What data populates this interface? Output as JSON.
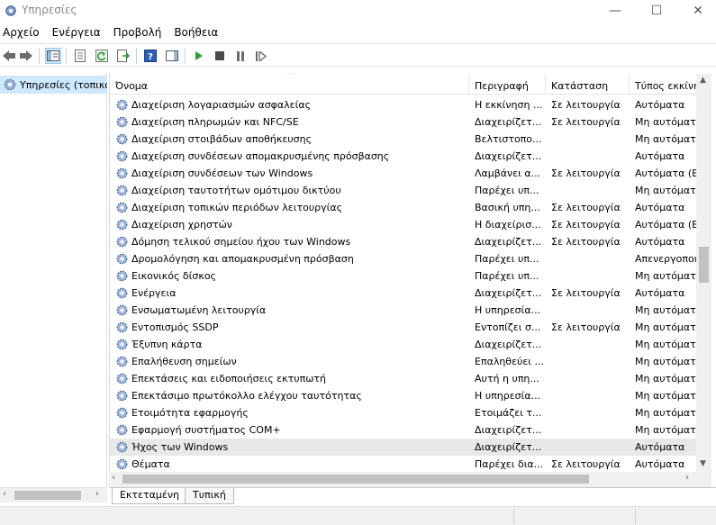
{
  "window": {
    "title": "Υπηρεσίες",
    "minimize": "—",
    "maximize": "☐",
    "close": "✕"
  },
  "menu": [
    "Αρχείο",
    "Ενέργεια",
    "Προβολή",
    "Βοήθεια"
  ],
  "toolbar": [
    "back-arrow",
    "forward-arrow",
    "show-tree",
    "properties",
    "refresh",
    "export-list",
    "help",
    "show-action-pane",
    "start-service",
    "stop-service",
    "pause-service",
    "restart-service"
  ],
  "tree": {
    "root_label": "Υπηρεσίες (τοπικά)"
  },
  "columns": {
    "name": "Όνομα",
    "description": "Περιγραφή",
    "status": "Κατάσταση",
    "startup": "Τύπος εκκίνησης"
  },
  "services": [
    {
      "name": "Διαχείριση λογαριασμών ασφαλείας",
      "description": "Η εκκίνηση ...",
      "status": "Σε λειτουργία",
      "startup": "Αυτόματα"
    },
    {
      "name": "Διαχείριση πληρωμών και NFC/SE",
      "description": "Διαχειρίζετ...",
      "status": "Σε λειτουργία",
      "startup": "Μη αυτόματα"
    },
    {
      "name": "Διαχείριση στοιβάδων αποθήκευσης",
      "description": "Βελτιστοπο...",
      "status": "",
      "startup": "Μη αυτόματα"
    },
    {
      "name": "Διαχείριση συνδέσεων απομακρυσμένης πρόσβασης",
      "description": "Διαχειρίζετ...",
      "status": "",
      "startup": "Αυτόματα"
    },
    {
      "name": "Διαχείριση συνδέσεων των Windows",
      "description": "Λαμβάνει α...",
      "status": "Σε λειτουργία",
      "startup": "Αυτόματα (Ε"
    },
    {
      "name": "Διαχείριση ταυτοτήτων ομότιμου δικτύου",
      "description": "Παρέχει υπ...",
      "status": "",
      "startup": "Μη αυτόματα"
    },
    {
      "name": "Διαχείριση τοπικών περιόδων λειτουργίας",
      "description": "Βασική υπη...",
      "status": "Σε λειτουργία",
      "startup": "Αυτόματα"
    },
    {
      "name": "Διαχείριση χρηστών",
      "description": "Η διαχείρισ...",
      "status": "Σε λειτουργία",
      "startup": "Αυτόματα (Ε"
    },
    {
      "name": "Δόμηση τελικού σημείου ήχου των Windows",
      "description": "Διαχειρίζετ...",
      "status": "Σε λειτουργία",
      "startup": "Αυτόματα"
    },
    {
      "name": "Δρομολόγηση και απομακρυσμένη πρόσβαση",
      "description": "Παρέχει υπ...",
      "status": "",
      "startup": "Απενεργοποι"
    },
    {
      "name": "Εικονικός δίσκος",
      "description": "Παρέχει υπ...",
      "status": "",
      "startup": "Μη αυτόματα"
    },
    {
      "name": "Ενέργεια",
      "description": "Διαχειρίζετ...",
      "status": "Σε λειτουργία",
      "startup": "Αυτόματα"
    },
    {
      "name": "Ενσωματωμένη λειτουργία",
      "description": "Η υπηρεσία...",
      "status": "",
      "startup": "Μη αυτόματα"
    },
    {
      "name": "Εντοπισμός SSDP",
      "description": "Εντοπίζει σ...",
      "status": "Σε λειτουργία",
      "startup": "Μη αυτόματα"
    },
    {
      "name": "Έξυπνη κάρτα",
      "description": "Διαχειρίζετ...",
      "status": "",
      "startup": "Μη αυτόματα"
    },
    {
      "name": "Επαλήθευση σημείων",
      "description": "Επαληθεύει ...",
      "status": "",
      "startup": "Μη αυτόματα"
    },
    {
      "name": "Επεκτάσεις και ειδοποιήσεις εκτυπωτή",
      "description": "Αυτή η υπη...",
      "status": "",
      "startup": "Μη αυτόματα"
    },
    {
      "name": "Επεκτάσιμο πρωτόκολλο ελέγχου ταυτότητας",
      "description": "Η υπηρεσία...",
      "status": "",
      "startup": "Μη αυτόματα"
    },
    {
      "name": "Ετοιμότητα εφαρμογής",
      "description": "Ετοιμάζει τ...",
      "status": "",
      "startup": "Μη αυτόματα"
    },
    {
      "name": "Εφαρμογή συστήματος COM+",
      "description": "Διαχειρίζετ...",
      "status": "",
      "startup": "Μη αυτόματα"
    },
    {
      "name": "Ήχος των Windows",
      "description": "Διαχειρίζετ...",
      "status": "",
      "startup": "Αυτόματα",
      "selected": true
    },
    {
      "name": "Θέματα",
      "description": "Παρέχει δια...",
      "status": "Σε λειτουργία",
      "startup": "Αυτόματα"
    }
  ],
  "tabs": {
    "extended": "Εκτεταμένη",
    "standard": "Τυπική"
  },
  "colors": {
    "selection": "#cde8ff",
    "row_selected": "#e8e8e8",
    "gear_blue": "#4a6ea8",
    "play_green": "#2e9b3a"
  }
}
